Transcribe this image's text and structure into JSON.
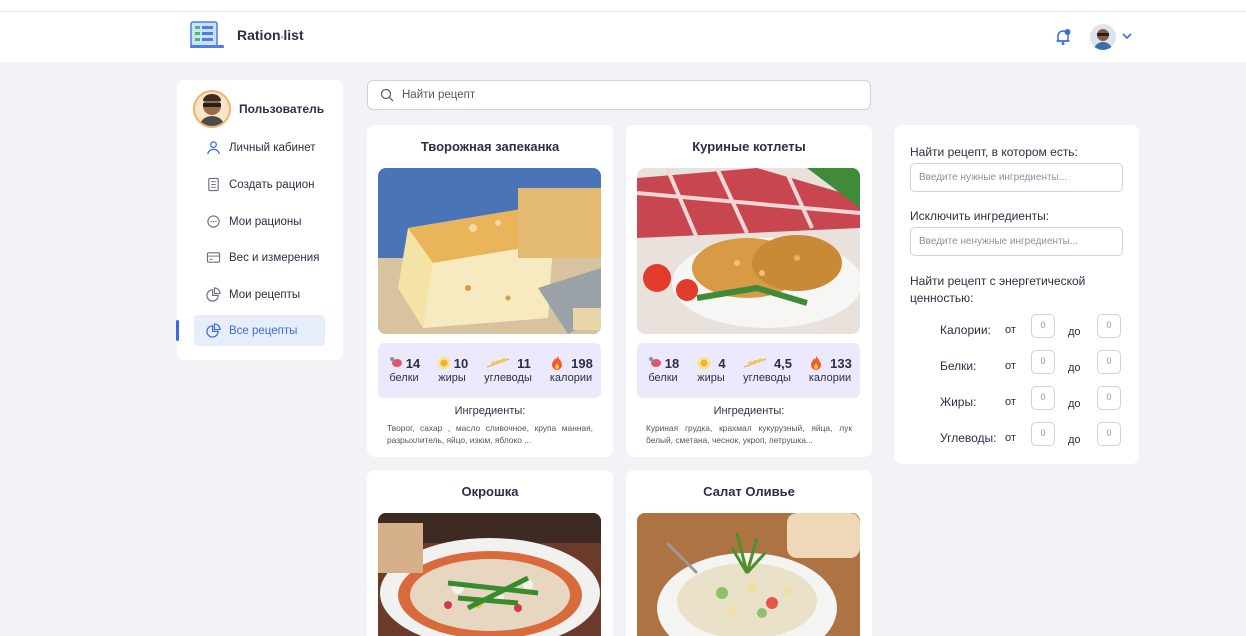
{
  "app": {
    "name": "Ration",
    "name_suffix": "list"
  },
  "sidebar": {
    "user_name": "Пользователь",
    "items": [
      {
        "label": "Личный кабинет",
        "icon": "user-icon"
      },
      {
        "label": "Создать рацион",
        "icon": "document-icon"
      },
      {
        "label": "Мои рационы",
        "icon": "chat-icon"
      },
      {
        "label": "Вес и измерения",
        "icon": "card-icon"
      },
      {
        "label": "Мои рецепты",
        "icon": "pie-chart-icon"
      },
      {
        "label": "Все рецепты",
        "icon": "pie-chart-icon",
        "active": true
      }
    ]
  },
  "search": {
    "placeholder": "Найти рецепт"
  },
  "recipes": [
    {
      "title": "Творожная запеканка",
      "protein": "14",
      "fat": "10",
      "carbs": "11",
      "calories": "198",
      "ingredients_heading": "Ингредиенты:",
      "ingredients": "Творог, сахар , масло сливочное, крупа манная, разрыхлитель, яйцо, изюм, яблоко ..."
    },
    {
      "title": "Куриные котлеты",
      "protein": "18",
      "fat": "4",
      "carbs": "4,5",
      "calories": "133",
      "ingredients_heading": "Ингредиенты:",
      "ingredients": "Куриная грудка, крахмал кукурузный, яйца, лук белый, сметана, чеснок, укроп, петрушка..."
    },
    {
      "title": "Окрошка"
    },
    {
      "title": "Салат Оливье"
    }
  ],
  "nutrient_labels": {
    "protein": "белки",
    "fat": "жиры",
    "carbs": "углеводы",
    "calories": "калории"
  },
  "filter": {
    "include_label": "Найти рецепт, в котором есть:",
    "include_placeholder": "Введите нужные ингредиенты...",
    "exclude_label": "Исключить ингредиенты:",
    "exclude_placeholder": "Введите ненужные ингредиенты...",
    "energy_label": "Найти рецепт с энергетической ценностью:",
    "from": "от",
    "to": "до",
    "ranges": [
      {
        "label": "Калории:",
        "min": "0",
        "max": "0"
      },
      {
        "label": "Белки:",
        "min": "0",
        "max": "0"
      },
      {
        "label": "Жиры:",
        "min": "0",
        "max": "0"
      },
      {
        "label": "Углеводы:",
        "min": "0",
        "max": "0"
      }
    ]
  },
  "colors": {
    "accent": "#3a6be0",
    "nutrition_bg": "#ebe9fb",
    "page_bg": "#f2f3f7"
  }
}
